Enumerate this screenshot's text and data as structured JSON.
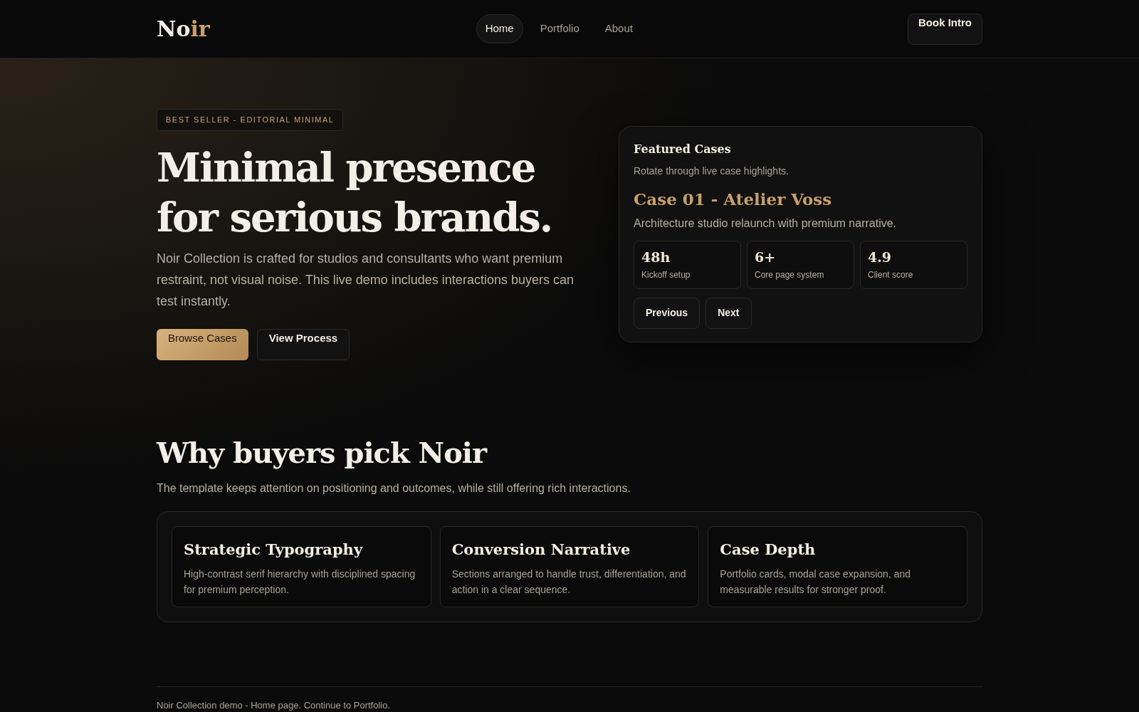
{
  "header": {
    "logo": [
      {
        "text": "No",
        "accent": false
      },
      {
        "text": "ir",
        "accent": true
      }
    ],
    "nav": [
      {
        "label": "Home",
        "selected": true
      },
      {
        "label": "Portfolio",
        "selected": false
      },
      {
        "label": "About",
        "selected": false
      }
    ],
    "cta": "Book Intro"
  },
  "hero": {
    "badge": "BEST SELLER - EDITORIAL MINIMAL",
    "title_lines": [
      "Minimal presence",
      "for serious brands."
    ],
    "lead": "Noir Collection is crafted for studios and consultants who want premium restraint, not visual noise. This live demo includes interactions buyers can test instantly.",
    "buttons": [
      {
        "label": "Browse Cases",
        "kind": "primary"
      },
      {
        "label": "View Process",
        "kind": "secondary"
      }
    ]
  },
  "featured": {
    "title": "Featured Cases",
    "subtitle": "Rotate through live case highlights.",
    "case_title": "Case 01 - Atelier Voss",
    "case_text": "Architecture studio relaunch with premium narrative.",
    "stats": [
      {
        "value": "48h",
        "label": "Kickoff setup"
      },
      {
        "value": "6+",
        "label": "Core page system"
      },
      {
        "value": "4.9",
        "label": "Client score"
      }
    ],
    "buttons": [
      "Previous",
      "Next"
    ]
  },
  "why": {
    "title": "Why buyers pick Noir",
    "subtitle": "The template keeps attention on positioning and outcomes, while still offering rich interactions.",
    "cards": [
      {
        "title": "Strategic Typography",
        "text": "High-contrast serif hierarchy with disciplined spacing for premium perception."
      },
      {
        "title": "Conversion Narrative",
        "text": "Sections arranged to handle trust, differentiation, and action in a clear sequence."
      },
      {
        "title": "Case Depth",
        "text": "Portfolio cards, modal case expansion, and measurable results for stronger proof."
      }
    ]
  },
  "footer": "Noir Collection demo - Home page. Continue to Portfolio."
}
